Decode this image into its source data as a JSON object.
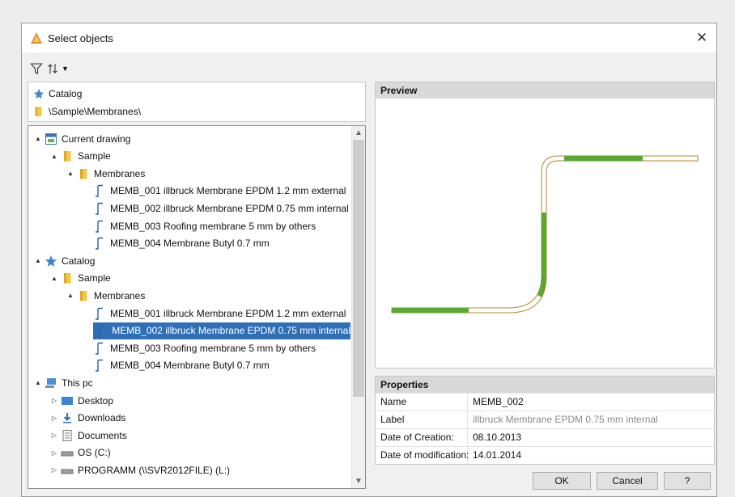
{
  "window": {
    "title": "Select objects"
  },
  "path": {
    "root": "Catalog",
    "folder": "\\Sample\\Membranes\\"
  },
  "tree": [
    {
      "indent": 0,
      "toggle": "▲",
      "icon": "drawing",
      "label": "Current drawing"
    },
    {
      "indent": 1,
      "toggle": "▲",
      "icon": "folder",
      "label": "Sample"
    },
    {
      "indent": 2,
      "toggle": "▲",
      "icon": "folder",
      "label": "Membranes"
    },
    {
      "indent": 3,
      "toggle": "",
      "icon": "membrane",
      "label": "MEMB_001 illbruck Membrane EPDM 1.2 mm external"
    },
    {
      "indent": 3,
      "toggle": "",
      "icon": "membrane",
      "label": "MEMB_002 illbruck Membrane EPDM 0.75 mm internal"
    },
    {
      "indent": 3,
      "toggle": "",
      "icon": "membrane",
      "label": "MEMB_003 Roofing membrane 5 mm by others"
    },
    {
      "indent": 3,
      "toggle": "",
      "icon": "membrane",
      "label": "MEMB_004 Membrane Butyl 0.7 mm"
    },
    {
      "indent": 0,
      "toggle": "▲",
      "icon": "star",
      "label": "Catalog"
    },
    {
      "indent": 1,
      "toggle": "▲",
      "icon": "folder",
      "label": "Sample"
    },
    {
      "indent": 2,
      "toggle": "▲",
      "icon": "folder",
      "label": "Membranes"
    },
    {
      "indent": 3,
      "toggle": "",
      "icon": "membrane",
      "label": "MEMB_001 illbruck Membrane EPDM 1.2 mm external"
    },
    {
      "indent": 3,
      "toggle": "",
      "icon": "membrane",
      "label": "MEMB_002 illbruck Membrane EPDM 0.75 mm internal",
      "selected": true
    },
    {
      "indent": 3,
      "toggle": "",
      "icon": "membrane",
      "label": "MEMB_003 Roofing membrane 5 mm by others"
    },
    {
      "indent": 3,
      "toggle": "",
      "icon": "membrane",
      "label": "MEMB_004 Membrane Butyl 0.7 mm"
    },
    {
      "indent": 0,
      "toggle": "▲",
      "icon": "pc",
      "label": "This pc"
    },
    {
      "indent": 1,
      "toggle": "▷",
      "icon": "desktop",
      "label": "Desktop"
    },
    {
      "indent": 1,
      "toggle": "▷",
      "icon": "download",
      "label": "Downloads"
    },
    {
      "indent": 1,
      "toggle": "▷",
      "icon": "documents",
      "label": "Documents"
    },
    {
      "indent": 1,
      "toggle": "▷",
      "icon": "drive",
      "label": "OS (C:)"
    },
    {
      "indent": 1,
      "toggle": "▷",
      "icon": "drive",
      "label": "PROGRAMM (\\\\SVR2012FILE) (L:)"
    }
  ],
  "preview": {
    "title": "Preview"
  },
  "properties": {
    "title": "Properties",
    "rows": [
      {
        "name": "Name",
        "value": "MEMB_002",
        "muted": false
      },
      {
        "name": "Label",
        "value": "illbruck Membrane EPDM 0.75 mm internal",
        "muted": true
      },
      {
        "name": "Date of Creation:",
        "value": "08.10.2013",
        "muted": false
      },
      {
        "name": "Date of modification:",
        "value": "14.01.2014",
        "muted": false
      }
    ]
  },
  "buttons": {
    "ok": "OK",
    "cancel": "Cancel",
    "help": "?"
  },
  "colors": {
    "selection": "#2f6fb8",
    "membrane_green": "#5aa832",
    "membrane_outline": "#b08a2a"
  }
}
